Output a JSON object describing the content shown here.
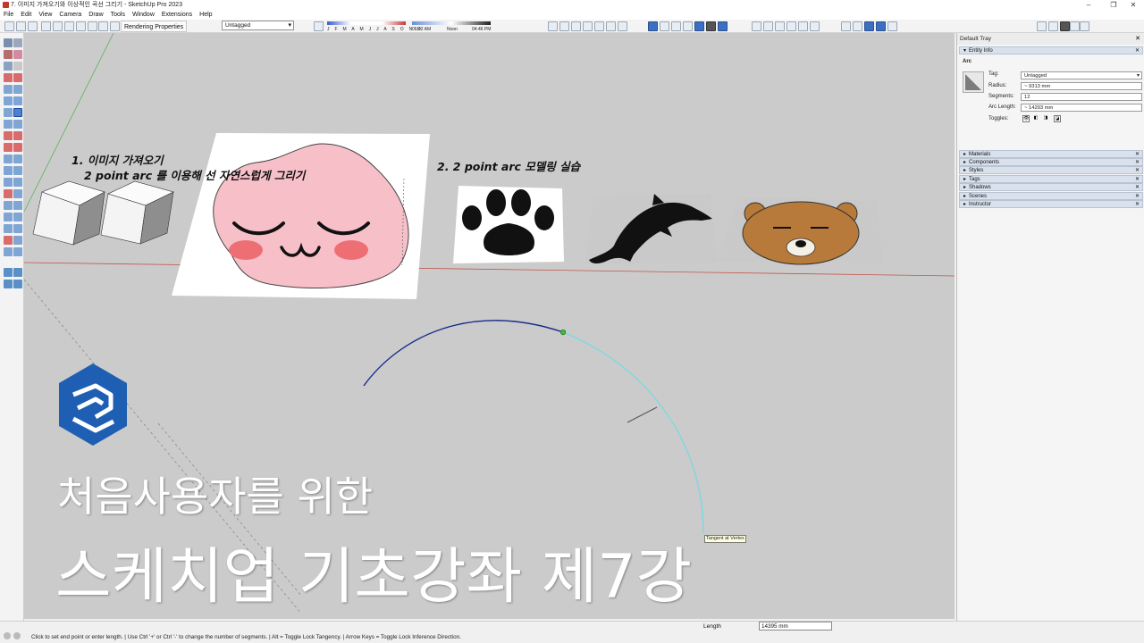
{
  "window": {
    "title": "7. 이미지 가져오기와 이상적인 곡선 그리기 - SketchUp Pro 2023",
    "controls": [
      "–",
      "❐",
      "✕"
    ]
  },
  "menu": [
    "File",
    "Edit",
    "View",
    "Camera",
    "Draw",
    "Tools",
    "Window",
    "Extensions",
    "Help"
  ],
  "toolbar": {
    "rendering_properties": "Rendering Properties",
    "tag_select": "Untagged",
    "months": "J F M A M J J A S O N D",
    "time_start": "06:42 AM",
    "time_noon": "Noon",
    "time_end": "04:46 PM"
  },
  "viewport": {
    "step1_line1": "1. 이미지 가져오기",
    "step1_line2": "2 point arc 를 이용해 선 자연스럽게 그리기",
    "step2": "2. 2 point arc 모델링 실습",
    "overlay_sub": "처음사용자를 위한",
    "overlay_title": "스케치업 기초강좌 제7강",
    "tooltip": "Tangent at Vertex",
    "colors": {
      "background": "#cbcbcb",
      "arc_blue": "#1a2a8a",
      "arc_cyan": "#7fd8e0",
      "axis_red": "#c0392b",
      "axis_green": "#5ab35a",
      "peach": "#f7c0c8",
      "bear": "#b87a3a",
      "logo": "#1e5fb3"
    }
  },
  "tray": {
    "title": "Default Tray",
    "entity_info": "Entity Info",
    "entity_type": "Arc",
    "fields": {
      "tag_label": "Tag:",
      "tag_value": "Untagged",
      "radius_label": "Radius:",
      "radius_value": "~ 9313 mm",
      "segments_label": "Segments:",
      "segments_value": "12",
      "arc_length_label": "Arc Length:",
      "arc_length_value": "~ 14293 mm",
      "toggles_label": "Toggles:"
    },
    "panels": [
      "Materials",
      "Components",
      "Styles",
      "Tags",
      "Shadows",
      "Scenes",
      "Instructor"
    ]
  },
  "status": {
    "text": "Click to set end point or enter length. | Use Ctrl '+' or Ctrl '-' to change the number of segments. | Alt = Toggle Lock Tangency. | Arrow Keys = Toggle Lock Inference Direction.",
    "measure_label": "Length",
    "measure_value": "14395 mm"
  }
}
